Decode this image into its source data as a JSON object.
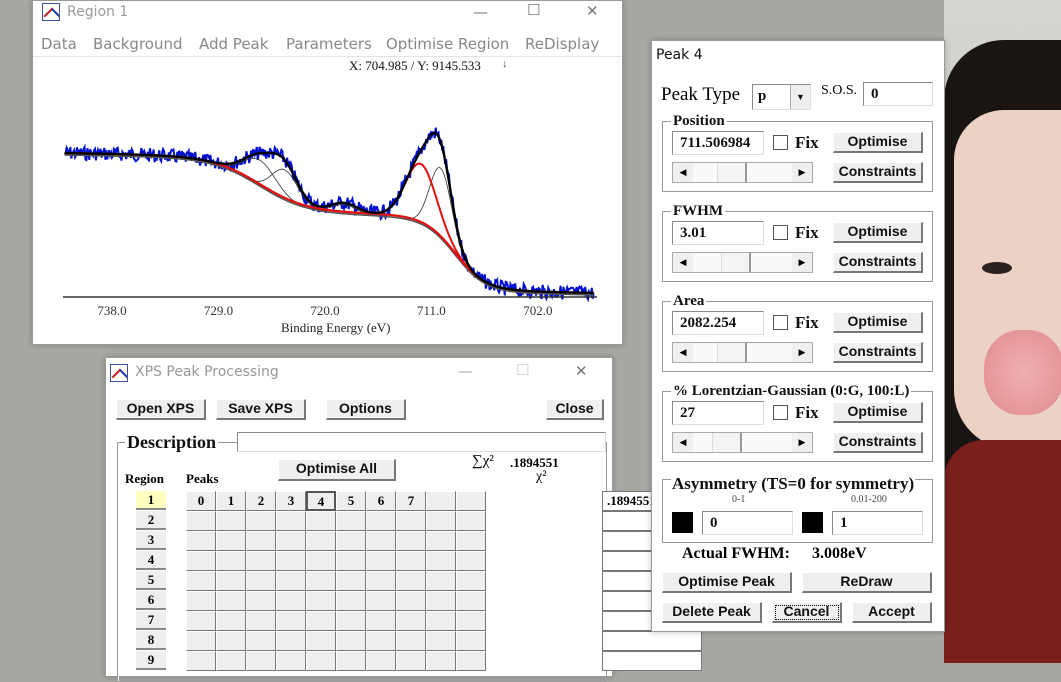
{
  "colors": {
    "data": "#0010d0",
    "envelope": "#000000",
    "background_line": "#e01010",
    "selected_peak": "#e01010",
    "desktop": "#a8a8a3",
    "region_selected": "#ffffc0"
  },
  "region_window": {
    "title": "Region 1",
    "menu": [
      "Data",
      "Background",
      "Add Peak",
      "Parameters",
      "Optimise Region",
      "ReDisplay"
    ],
    "cursor_readout": "X: 704.985 / Y: 9145.533",
    "readout_arrow": "↓",
    "x_ticks": [
      "738.0",
      "729.0",
      "720.0",
      "711.0",
      "702.0"
    ],
    "x_label": "Binding Energy (eV)"
  },
  "processing_window": {
    "title": "XPS Peak Processing",
    "buttons": {
      "open": "Open XPS",
      "save": "Save XPS",
      "options": "Options",
      "close": "Close",
      "optimise_all": "Optimise All"
    },
    "description_label": "Description",
    "description_value": "",
    "region_label": "Region",
    "peaks_label": "Peaks",
    "sum_chi_label": "∑χ²",
    "sum_chi_value": ".1894551",
    "chi_label": "χ²",
    "peak_headers": [
      "0",
      "1",
      "2",
      "3",
      "4",
      "5",
      "6",
      "7",
      "",
      ""
    ],
    "selected_peak": "4",
    "regions": [
      "1",
      "2",
      "3",
      "4",
      "5",
      "6",
      "7",
      "8",
      "9"
    ],
    "selected_region": "1",
    "chi_values": [
      ".1894551",
      "",
      "",
      "",
      "",
      "",
      "",
      "",
      ""
    ]
  },
  "peak_window": {
    "title": "Peak 4",
    "peak_type_label": "Peak Type",
    "peak_type_value": "p",
    "sos_label": "S.O.S.",
    "sos_value": "0",
    "fix_label": "Fix",
    "optimise_label": "Optimise",
    "constraints_label": "Constraints",
    "groups": [
      {
        "label": "Position",
        "value": "711.506984",
        "fixed": false,
        "slider": 0.35
      },
      {
        "label": "FWHM",
        "value": "3.01",
        "fixed": false,
        "slider": 0.4
      },
      {
        "label": "Area",
        "value": "2082.254",
        "fixed": false,
        "slider": 0.35
      },
      {
        "label": "% Lorentzian-Gaussian (0:G, 100:L)",
        "value": "27",
        "fixed": false,
        "slider": 0.27
      }
    ],
    "asymmetry": {
      "label": "Asymmetry (TS=0 for symmetry)",
      "range1": "0-1",
      "range2": "0.01-200",
      "value1": "0",
      "value2": "1"
    },
    "actual_fwhm_label": "Actual FWHM:",
    "actual_fwhm_value": "3.008eV",
    "buttons": {
      "optimise_peak": "Optimise Peak",
      "redraw": "ReDraw",
      "delete": "Delete Peak",
      "cancel": "Cancel",
      "accept": "Accept"
    }
  }
}
